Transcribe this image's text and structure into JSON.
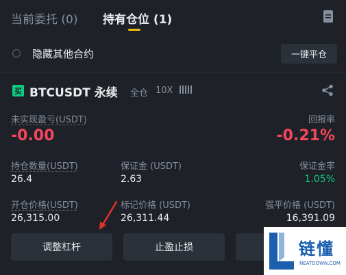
{
  "tabs": {
    "open_orders": "当前委托 (0)",
    "positions": "持有仓位 (1)"
  },
  "toolbar": {
    "hide_other_label": "隐藏其他合约",
    "close_all_label": "一键平仓"
  },
  "position": {
    "symbol": "BTCUSDT 永续",
    "margin_mode": "全仓",
    "leverage": "10X",
    "side_badge": "买",
    "unrealized_pnl_label": "未实现盈亏(USDT)",
    "unrealized_pnl_value": "-0.00",
    "roe_label": "回报率",
    "roe_value": "-0.21%",
    "size_label": "持仓数量(USDT)",
    "size_value": "26.4",
    "margin_label": "保证金 (USDT)",
    "margin_value": "2.63",
    "margin_ratio_label": "保证金率",
    "margin_ratio_value": "1.05%",
    "entry_label": "开仓价格(USDT)",
    "entry_value": "26,315.00",
    "mark_label": "标记价格 (USDT)",
    "mark_value": "26,311.44",
    "liq_label": "强平价格 (USDT)",
    "liq_value": "16,391.09"
  },
  "actions": {
    "adjust_leverage": "调整杠杆",
    "tp_sl": "止盈止损"
  },
  "watermark": {
    "name": "链懂",
    "site": "NEATDOWN.COM"
  },
  "colors": {
    "accent": "#f0b90b",
    "negative": "#f6465d",
    "positive": "#0ecb81",
    "arrow": "#e0312b"
  }
}
